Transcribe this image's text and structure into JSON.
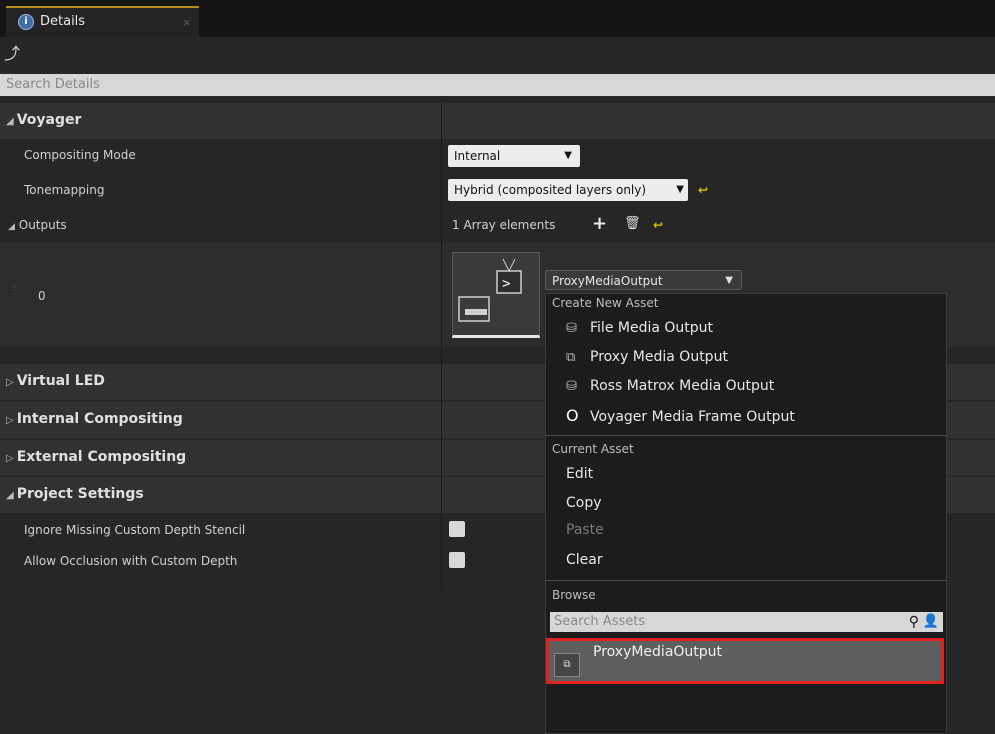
{
  "tab": {
    "title": "Details",
    "close": "×",
    "icon": "info-icon"
  },
  "search": {
    "placeholder": "Search Details"
  },
  "categories": {
    "voyager": "Voyager",
    "virtual_led": "Virtual LED",
    "internal_compositing": "Internal Compositing",
    "external_compositing": "External Compositing",
    "project_settings": "Project Settings"
  },
  "properties": {
    "compositing_mode": {
      "label": "Compositing Mode",
      "value": "Internal"
    },
    "tonemapping": {
      "label": "Tonemapping",
      "value": "Hybrid (composited layers only)"
    },
    "outputs": {
      "label": "Outputs",
      "value": "1 Array elements"
    },
    "output_index": "0",
    "output_asset": "ProxyMediaOutput",
    "ignore_missing": {
      "label": "Ignore Missing Custom Depth Stencil",
      "checked": false
    },
    "allow_occlusion": {
      "label": "Allow Occlusion with Custom Depth",
      "checked": false
    }
  },
  "menu": {
    "create_header": "Create New Asset",
    "create_items": [
      "File Media Output",
      "Proxy Media Output",
      "Ross Matrox Media Output",
      "Voyager Media Frame Output"
    ],
    "current_header": "Current Asset",
    "current_items": [
      "Edit",
      "Copy",
      "Paste",
      "Clear"
    ],
    "browse_header": "Browse",
    "search_placeholder": "Search Assets",
    "asset_name": "ProxyMediaOutput"
  },
  "colors": {
    "accent_tab": "#b98c1f",
    "reset_yellow": "#e4c000",
    "highlight_red": "#e12020"
  }
}
